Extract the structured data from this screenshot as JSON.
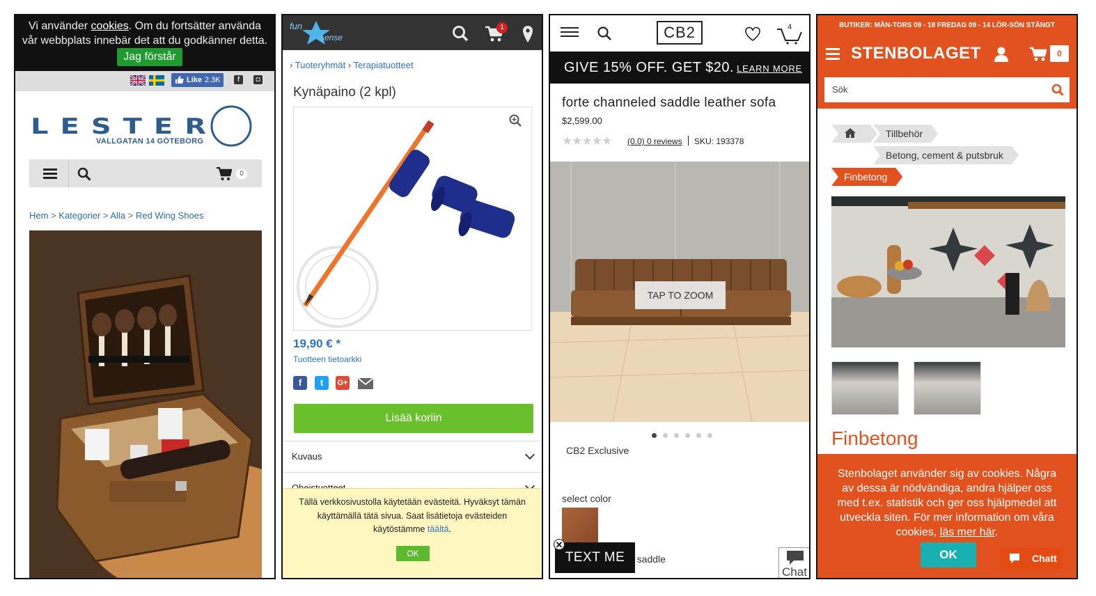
{
  "lester": {
    "cookie": {
      "pre": "Vi använder ",
      "link": "cookies",
      "post": ". Om du fortsätter använda vår webbplats innebär det att du godkänner detta.",
      "button": "Jag förstår"
    },
    "fb_like": "Like",
    "fb_count": "2.3K",
    "logo_text": "LESTER",
    "logo_sub": "VALLGATAN 14 GÖTEBORG",
    "cart_count": "0",
    "breadcrumb": [
      "Hem",
      "Kategorier",
      "Alla",
      "Red Wing Shoes"
    ],
    "icons": [
      "flag-uk-icon",
      "flag-se-icon",
      "facebook-icon",
      "instagram-icon",
      "menu-icon",
      "search-icon",
      "cart-icon"
    ]
  },
  "funsense": {
    "logo": {
      "line1": "fun",
      "line2": "sense"
    },
    "cart_badge": "1",
    "breadcrumb": [
      "Tuoteryhmät",
      "Terapiatuotteet"
    ],
    "title": "Kynäpaino (2 kpl)",
    "price": "19,90 € *",
    "datasheet": "Tuotteen tietoarkki",
    "add_to_cart": "Lisää koriin",
    "accordion": [
      "Kuvaus",
      "Oheistuotteet"
    ],
    "cookie": {
      "text": "Tällä verkkosivustolla käytetään evästeitä. Hyväksyt tämän käyttämällä tätä sivua. Saat lisätietoja evästeiden käytöstämme ",
      "link": "täältä",
      "end": ".",
      "button": "OK"
    },
    "icons": [
      "search-icon",
      "cart-icon",
      "location-icon",
      "zoom-icon",
      "facebook-icon",
      "twitter-icon",
      "google-plus-icon",
      "email-icon"
    ]
  },
  "cb2": {
    "logo": "CB2",
    "cart_count": "4",
    "promo": "GIVE 15% OFF. GET $20.",
    "promo_link": "LEARN MORE",
    "product_title": "forte channeled saddle leather sofa",
    "price": "$2,599.00",
    "stars": "★★★★★",
    "reviews": "(0.0) 0 reviews",
    "sku": "SKU: 193378",
    "tap_to_zoom": "TAP TO ZOOM",
    "exclusive": "CB2 Exclusive",
    "select_color": "select color",
    "color_name": "lo, saddle",
    "text_me": "TEXT ME",
    "chat": "Chat",
    "carousel_slides": 6,
    "carousel_active": 1,
    "icons": [
      "menu-icon",
      "search-icon",
      "heart-icon",
      "cart-icon",
      "chat-bubble-icon",
      "close-icon"
    ]
  },
  "stenbolaget": {
    "topbar": "BUTIKER:  MÅN-TORS 09 - 18  FREDAG 09 - 14  LÖR-SÖN STÄNGT",
    "brand": "STENBOLAGET",
    "cart_count": "0",
    "search_placeholder": "Sök",
    "breadcrumb": [
      "Tillbehör",
      "Betong, cement & putsbruk",
      "Finbetong"
    ],
    "heading": "Finbetong",
    "cookie": {
      "text": "Stenbolaget använder sig av cookies. Några av dessa är nödvändiga, andra hjälper oss med t.ex. statistik och ger oss hjälpmedel att utveckla siten. För mer information om våra cookies, ",
      "link": "läs mer här",
      "end": ".",
      "button": "OK"
    },
    "chat": "Chatt",
    "icons": [
      "menu-icon",
      "user-icon",
      "cart-icon",
      "search-icon",
      "home-icon",
      "chat-icon"
    ]
  }
}
